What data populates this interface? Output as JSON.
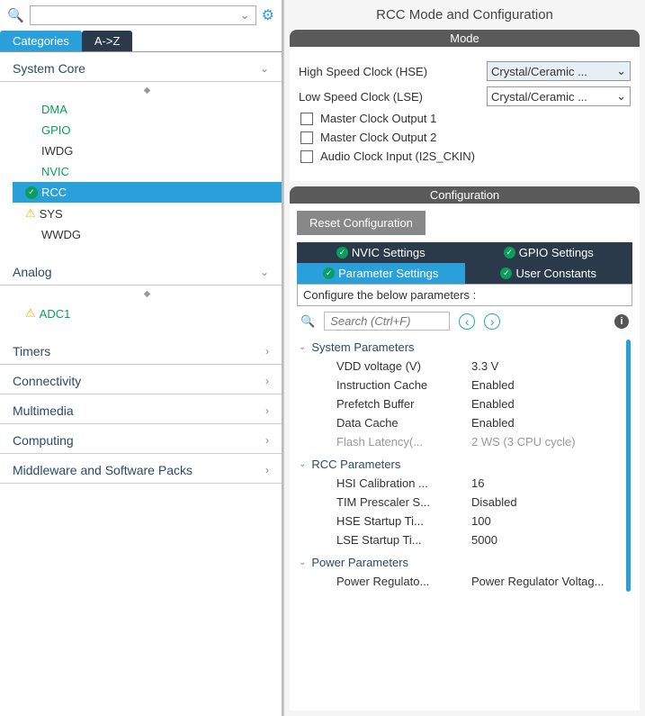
{
  "search": {
    "placeholder": ""
  },
  "tabs": {
    "categories": "Categories",
    "az": "A->Z"
  },
  "categories": {
    "systemCore": {
      "label": "System Core",
      "items": [
        {
          "label": "DMA",
          "cls": "green"
        },
        {
          "label": "GPIO",
          "cls": "green"
        },
        {
          "label": "IWDG",
          "cls": "plain"
        },
        {
          "label": "NVIC",
          "cls": "green"
        },
        {
          "label": "RCC",
          "cls": "selected",
          "icon": "check"
        },
        {
          "label": "SYS",
          "cls": "warn",
          "icon": "warn"
        },
        {
          "label": "WWDG",
          "cls": "plain"
        }
      ]
    },
    "analog": {
      "label": "Analog",
      "items": [
        {
          "label": "ADC1",
          "cls": "okg",
          "icon": "warn"
        }
      ]
    },
    "collapsed": [
      {
        "label": "Timers"
      },
      {
        "label": "Connectivity"
      },
      {
        "label": "Multimedia"
      },
      {
        "label": "Computing"
      },
      {
        "label": "Middleware and Software Packs"
      }
    ]
  },
  "right": {
    "title": "RCC Mode and Configuration",
    "modeTitle": "Mode",
    "hseLabel": "High Speed Clock (HSE)",
    "hseValue": "Crystal/Ceramic ...",
    "lseLabel": "Low Speed Clock (LSE)",
    "lseValue": "Crystal/Ceramic ...",
    "chk1": "Master Clock Output 1",
    "chk2": "Master Clock Output 2",
    "chk3": "Audio Clock Input (I2S_CKIN)",
    "configTitle": "Configuration",
    "resetBtn": "Reset Configuration",
    "cfgTabs": {
      "nvic": "NVIC Settings",
      "gpio": "GPIO Settings",
      "param": "Parameter Settings",
      "user": "User Constants"
    },
    "paramHint": "Configure the below parameters :",
    "paramSearch": "Search (Ctrl+F)",
    "tree": {
      "g1": {
        "title": "System Parameters",
        "params": [
          {
            "n": "VDD voltage (V)",
            "v": "3.3 V"
          },
          {
            "n": "Instruction Cache",
            "v": "Enabled"
          },
          {
            "n": "Prefetch Buffer",
            "v": "Enabled"
          },
          {
            "n": "Data Cache",
            "v": "Enabled"
          },
          {
            "n": "Flash Latency(...",
            "v": "2 WS (3 CPU cycle)",
            "dim": true
          }
        ]
      },
      "g2": {
        "title": "RCC Parameters",
        "params": [
          {
            "n": "HSI Calibration ...",
            "v": "16"
          },
          {
            "n": "TIM Prescaler S...",
            "v": "Disabled"
          },
          {
            "n": "HSE Startup Ti...",
            "v": "100"
          },
          {
            "n": "LSE Startup Ti...",
            "v": "5000"
          }
        ]
      },
      "g3": {
        "title": "Power Parameters",
        "params": [
          {
            "n": "Power Regulato...",
            "v": "Power Regulator Voltag..."
          }
        ]
      }
    }
  }
}
